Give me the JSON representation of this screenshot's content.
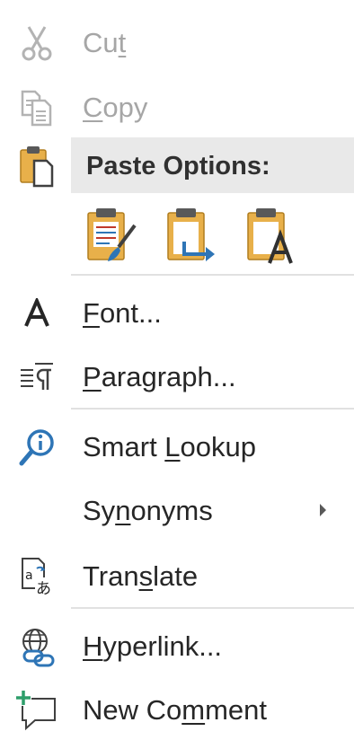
{
  "menu": {
    "cut": {
      "before": "Cu",
      "accel": "t",
      "after": "",
      "icon": "scissors-icon"
    },
    "copy": {
      "before": "",
      "accel": "C",
      "after": "opy",
      "icon": "copy-icon"
    },
    "paste_options": {
      "label": "Paste Options:",
      "icon": "paste-icon",
      "choices": [
        "keep-source-formatting-icon",
        "merge-formatting-icon",
        "keep-text-only-icon"
      ]
    },
    "font": {
      "before": "",
      "accel": "F",
      "after": "ont...",
      "icon": "font-icon"
    },
    "paragraph": {
      "before": "",
      "accel": "P",
      "after": "aragraph...",
      "icon": "paragraph-icon"
    },
    "smart_lookup": {
      "before": "Smart ",
      "accel": "L",
      "after": "ookup",
      "icon": "smart-lookup-icon"
    },
    "synonyms": {
      "before": "Sy",
      "accel": "n",
      "after": "onyms",
      "icon": "submenu-arrow-icon"
    },
    "translate": {
      "before": "Tran",
      "accel": "s",
      "after": "late",
      "icon": "translate-icon"
    },
    "hyperlink": {
      "before": "",
      "accel": "H",
      "after": "yperlink...",
      "icon": "hyperlink-icon"
    },
    "new_comment": {
      "before": "New Co",
      "accel": "m",
      "after": "ment",
      "icon": "new-comment-icon"
    }
  },
  "colors": {
    "disabled_text": "#a6a6a6",
    "text": "#262626",
    "accent_blue": "#2e75b6",
    "paste_gold": "#e8b04a",
    "header_bg": "#e9e9e9"
  }
}
